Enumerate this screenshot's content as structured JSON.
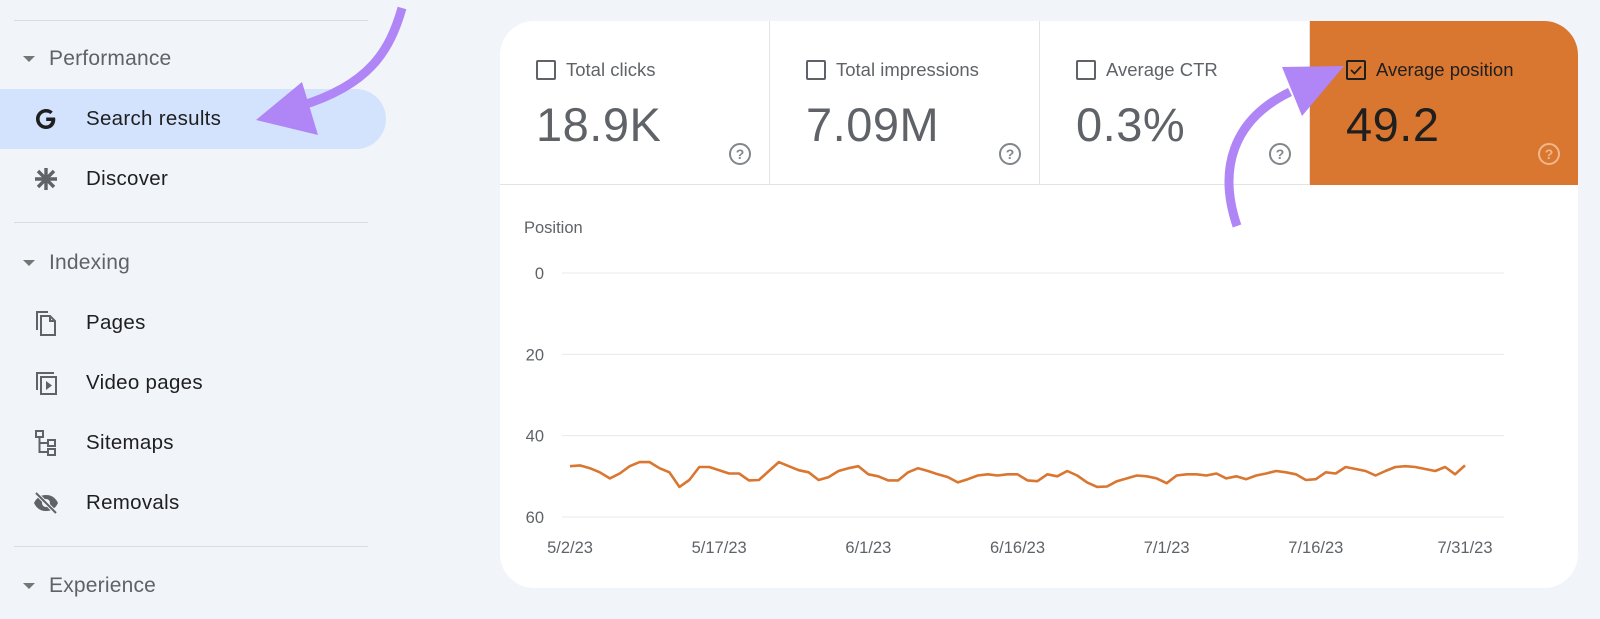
{
  "sidebar": {
    "sections": [
      {
        "label": "Performance",
        "items": [
          {
            "label": "Search results",
            "icon": "google-g-icon",
            "active": true
          },
          {
            "label": "Discover",
            "icon": "asterisk-icon",
            "active": false
          }
        ]
      },
      {
        "label": "Indexing",
        "items": [
          {
            "label": "Pages",
            "icon": "pages-icon",
            "active": false
          },
          {
            "label": "Video pages",
            "icon": "video-pages-icon",
            "active": false
          },
          {
            "label": "Sitemaps",
            "icon": "sitemap-icon",
            "active": false
          },
          {
            "label": "Removals",
            "icon": "eye-off-icon",
            "active": false
          }
        ]
      },
      {
        "label": "Experience",
        "items": []
      }
    ]
  },
  "metrics": [
    {
      "title": "Total clicks",
      "value": "18.9K",
      "checked": false
    },
    {
      "title": "Total impressions",
      "value": "7.09M",
      "checked": false
    },
    {
      "title": "Average CTR",
      "value": "0.3%",
      "checked": false
    },
    {
      "title": "Average position",
      "value": "49.2",
      "checked": true
    }
  ],
  "colors": {
    "selected_metric": "#d97630",
    "line": "#d97630",
    "annotation_arrow": "#b085f5",
    "active_nav": "#d3e3fd"
  },
  "help_glyph": "?",
  "chart_data": {
    "type": "line",
    "title": "",
    "ylabel": "Position",
    "xlabel": "",
    "y_inverted": true,
    "ylim": [
      0,
      60
    ],
    "yticks": [
      0,
      20,
      40,
      60
    ],
    "grid": true,
    "x_tick_labels": [
      "5/2/23",
      "5/17/23",
      "6/1/23",
      "6/16/23",
      "7/1/23",
      "7/16/23",
      "7/31/23"
    ],
    "x_start": "5/2/23",
    "x_end": "7/31/23",
    "series": [
      {
        "name": "Average position",
        "values": [
          47.5,
          47.3,
          48.0,
          49.0,
          50.5,
          49.3,
          47.5,
          46.5,
          46.5,
          48.0,
          49.0,
          52.6,
          50.9,
          47.7,
          47.7,
          48.5,
          49.3,
          49.3,
          51.0,
          50.9,
          48.7,
          46.5,
          47.5,
          48.5,
          49.0,
          50.9,
          50.2,
          48.7,
          48.0,
          47.5,
          49.5,
          50.0,
          51.0,
          51.0,
          49.0,
          48.0,
          48.7,
          49.5,
          50.2,
          51.5,
          50.7,
          49.8,
          49.5,
          49.8,
          49.5,
          49.5,
          51.0,
          51.2,
          49.5,
          50.0,
          48.7,
          49.8,
          51.5,
          52.6,
          52.5,
          51.2,
          50.5,
          49.8,
          50.0,
          50.5,
          51.7,
          49.8,
          49.5,
          49.5,
          49.8,
          49.3,
          50.5,
          50.0,
          50.7,
          49.8,
          49.3,
          48.7,
          49.0,
          49.5,
          50.9,
          50.7,
          49.0,
          49.3,
          47.7,
          48.2,
          48.7,
          49.8,
          48.7,
          47.7,
          47.5,
          47.7,
          48.2,
          48.7,
          47.7,
          49.5,
          47.3
        ]
      }
    ]
  }
}
